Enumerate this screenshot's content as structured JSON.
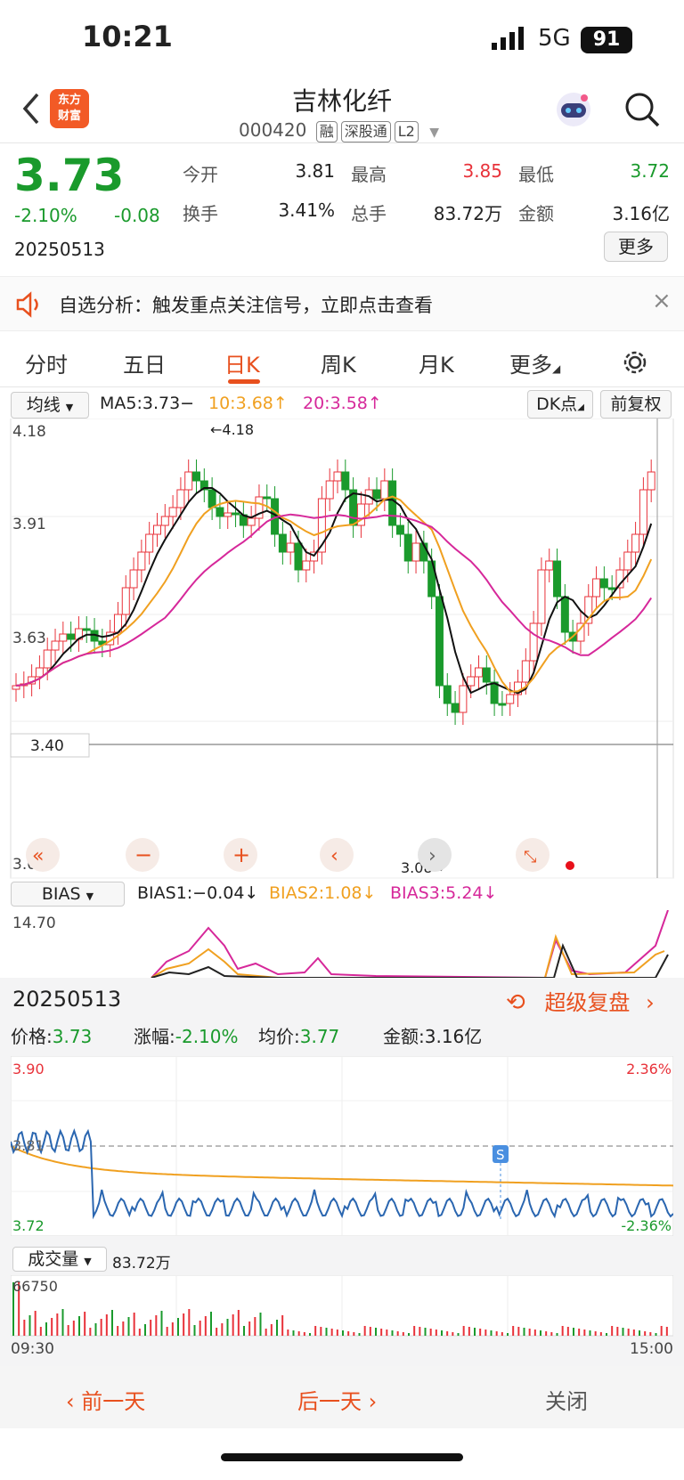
{
  "status": {
    "time": "10:21",
    "network": "5G",
    "battery": "91"
  },
  "header": {
    "title": "吉林化纤",
    "code": "000420",
    "tags": [
      "融",
      "深股通",
      "L2"
    ],
    "logo_line1": "东方",
    "logo_line2": "财富"
  },
  "quote": {
    "price": "3.73",
    "change_pct": "-2.10%",
    "change": "-0.08",
    "date": "20250513",
    "fields": [
      {
        "label": "今开",
        "value": "3.81",
        "color": "#222"
      },
      {
        "label": "最高",
        "value": "3.85",
        "color": "#e8323a"
      },
      {
        "label": "最低",
        "value": "3.72",
        "color": "#1a9a2c"
      },
      {
        "label": "换手",
        "value": "3.41%",
        "color": "#222"
      },
      {
        "label": "总手",
        "value": "83.72万",
        "color": "#222"
      },
      {
        "label": "金额",
        "value": "3.16亿",
        "color": "#222"
      }
    ],
    "more": "更多"
  },
  "notice": {
    "text": "自选分析：触发重点关注信号，立即点击查看"
  },
  "tabs": [
    "分时",
    "五日",
    "日K",
    "周K",
    "月K",
    "更多"
  ],
  "kline": {
    "ma_select": "均线",
    "ma5": "MA5:3.73−",
    "ma10": "10:3.68↑",
    "ma20": "20:3.58↑",
    "dk": "DK点",
    "fq": "前复权",
    "y_labels": [
      "4.18",
      "3.91",
      "3.63",
      "3.40",
      "3.08"
    ],
    "high_mark": "←4.18",
    "low_mark": "3.08→",
    "bias_select": "BIAS",
    "bias1": "BIAS1:−0.04↓",
    "bias2": "BIAS2:1.08↓",
    "bias3": "BIAS3:5.24↓",
    "bias_top": "14.70"
  },
  "detail": {
    "date": "20250513",
    "replay": "超级复盘",
    "price_label": "价格:",
    "price": "3.73",
    "pct_label": "涨幅:",
    "pct": "-2.10%",
    "avg_label": "均价:",
    "avg": "3.77",
    "amt_label": "金额:",
    "amt": "3.16亿",
    "y_top": "3.90",
    "y_mid": "3.81",
    "y_bot": "3.72",
    "pct_top": "2.36%",
    "pct_bot": "-2.36%",
    "signal": "S",
    "vol_select": "成交量",
    "vol_total": "83.72万",
    "vol_top": "66750",
    "t_start": "09:30",
    "t_end": "15:00"
  },
  "footer": {
    "prev": "前一天",
    "next": "后一天",
    "close": "关闭"
  },
  "colors": {
    "up": "#e8323a",
    "down": "#1a9a2c",
    "accent": "#e8501e",
    "ma10": "#f0a020",
    "ma20": "#d6289a"
  }
}
